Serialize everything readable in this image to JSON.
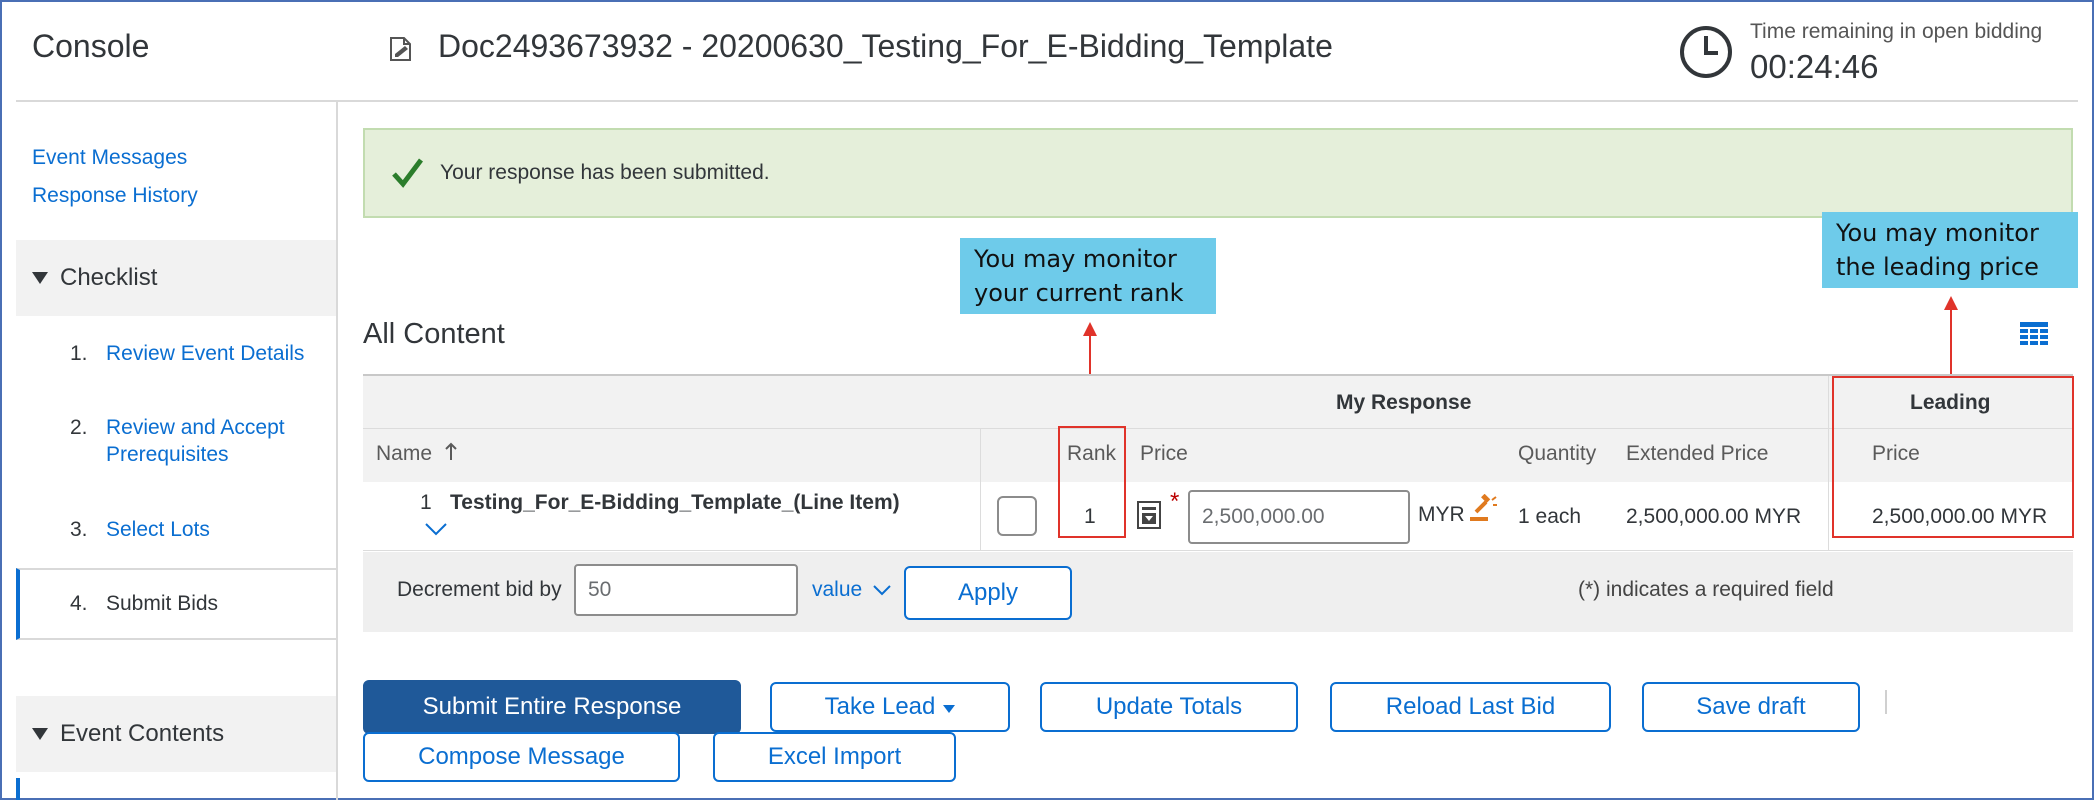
{
  "header": {
    "console_title": "Console",
    "document_title": "Doc2493673932 - 20200630_Testing_For_E-Bidding_Template",
    "time_label": "Time remaining in open bidding",
    "time_remaining": "00:24:46"
  },
  "sidebar": {
    "links": [
      "Event Messages",
      "Response History"
    ],
    "checklist_title": "Checklist",
    "steps": [
      {
        "num": "1.",
        "label": "Review Event Details"
      },
      {
        "num": "2.",
        "label_line1": "Review and Accept",
        "label_line2": "Prerequisites"
      },
      {
        "num": "3.",
        "label": "Select Lots"
      },
      {
        "num": "4.",
        "label": "Submit Bids"
      }
    ],
    "event_contents_title": "Event Contents"
  },
  "success_message": "Your response has been submitted.",
  "callouts": {
    "rank_line1": "You may monitor",
    "rank_line2": "your current rank",
    "price_line1": "You may monitor",
    "price_line2": "the leading price"
  },
  "content": {
    "title": "All Content",
    "group_my_response": "My Response",
    "group_leading": "Leading",
    "columns": {
      "name": "Name",
      "rank": "Rank",
      "price": "Price",
      "quantity": "Quantity",
      "extended_price": "Extended Price",
      "leading_price": "Price"
    },
    "row": {
      "num": "1",
      "name": "Testing_For_E-Bidding_Template_(Line Item)",
      "rank": "1",
      "price_value": "2,500,000.00",
      "currency": "MYR",
      "quantity": "1 each",
      "extended_price": "2,500,000.00 MYR",
      "leading_price": "2,500,000.00 MYR"
    },
    "decrement_label": "Decrement bid by",
    "decrement_value": "50",
    "value_dropdown": "value",
    "apply_label": "Apply",
    "required_note": "(*) indicates a required field"
  },
  "buttons": {
    "submit": "Submit Entire Response",
    "take_lead": "Take Lead",
    "update_totals": "Update Totals",
    "reload_last_bid": "Reload Last Bid",
    "save_draft": "Save draft",
    "compose_message": "Compose Message",
    "excel_import": "Excel Import"
  },
  "colors": {
    "accent": "#0a6ed1",
    "primary_button": "#1f5999",
    "success_bg": "#e5efda",
    "callout_bg": "#6ecbea",
    "annotation_red": "#e0332a"
  }
}
